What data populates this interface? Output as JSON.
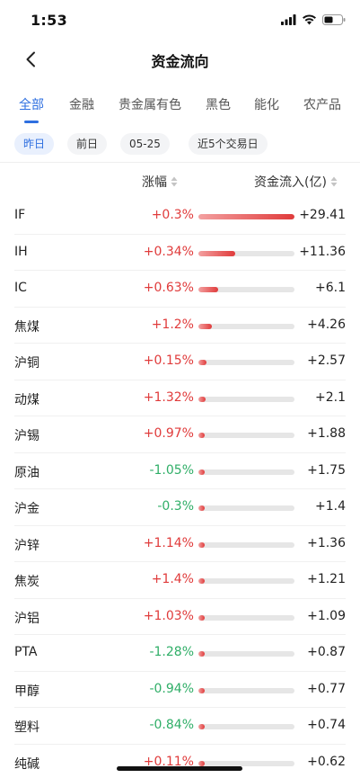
{
  "status_bar": {
    "time": "1:53"
  },
  "nav": {
    "title": "资金流向"
  },
  "tabs": [
    {
      "label": "全部",
      "active": true
    },
    {
      "label": "金融",
      "active": false
    },
    {
      "label": "贵金属有色",
      "active": false
    },
    {
      "label": "黑色",
      "active": false
    },
    {
      "label": "能化",
      "active": false
    },
    {
      "label": "农产品",
      "active": false
    }
  ],
  "chips": [
    {
      "label": "昨日",
      "active": true
    },
    {
      "label": "前日",
      "active": false
    },
    {
      "label": "05-25",
      "active": false
    },
    {
      "label": "近5个交易日",
      "active": false
    }
  ],
  "table": {
    "header_change": "涨幅",
    "header_inflow": "资金流入(亿)",
    "max_inflow": 29.41,
    "rows": [
      {
        "name": "IF",
        "change": "+0.3%",
        "inflow": "+29.41",
        "value": 29.41,
        "dir": "up"
      },
      {
        "name": "IH",
        "change": "+0.34%",
        "inflow": "+11.36",
        "value": 11.36,
        "dir": "up"
      },
      {
        "name": "IC",
        "change": "+0.63%",
        "inflow": "+6.1",
        "value": 6.1,
        "dir": "up"
      },
      {
        "name": "焦煤",
        "change": "+1.2%",
        "inflow": "+4.26",
        "value": 4.26,
        "dir": "up"
      },
      {
        "name": "沪铜",
        "change": "+0.15%",
        "inflow": "+2.57",
        "value": 2.57,
        "dir": "up"
      },
      {
        "name": "动煤",
        "change": "+1.32%",
        "inflow": "+2.1",
        "value": 2.1,
        "dir": "up"
      },
      {
        "name": "沪锡",
        "change": "+0.97%",
        "inflow": "+1.88",
        "value": 1.88,
        "dir": "up"
      },
      {
        "name": "原油",
        "change": "-1.05%",
        "inflow": "+1.75",
        "value": 1.75,
        "dir": "down"
      },
      {
        "name": "沪金",
        "change": "-0.3%",
        "inflow": "+1.4",
        "value": 1.4,
        "dir": "down"
      },
      {
        "name": "沪锌",
        "change": "+1.14%",
        "inflow": "+1.36",
        "value": 1.36,
        "dir": "up"
      },
      {
        "name": "焦炭",
        "change": "+1.4%",
        "inflow": "+1.21",
        "value": 1.21,
        "dir": "up"
      },
      {
        "name": "沪铝",
        "change": "+1.03%",
        "inflow": "+1.09",
        "value": 1.09,
        "dir": "up"
      },
      {
        "name": "PTA",
        "change": "-1.28%",
        "inflow": "+0.87",
        "value": 0.87,
        "dir": "down"
      },
      {
        "name": "甲醇",
        "change": "-0.94%",
        "inflow": "+0.77",
        "value": 0.77,
        "dir": "down"
      },
      {
        "name": "塑料",
        "change": "-0.84%",
        "inflow": "+0.74",
        "value": 0.74,
        "dir": "down"
      },
      {
        "name": "纯碱",
        "change": "+0.11%",
        "inflow": "+0.62",
        "value": 0.62,
        "dir": "up"
      }
    ]
  },
  "colors": {
    "accent": "#2e6fe0",
    "up": "#e03b3b",
    "down": "#2fae67"
  },
  "icons": [
    "signal-icon",
    "wifi-icon",
    "battery-icon",
    "back-chevron-icon",
    "sort-icon"
  ]
}
